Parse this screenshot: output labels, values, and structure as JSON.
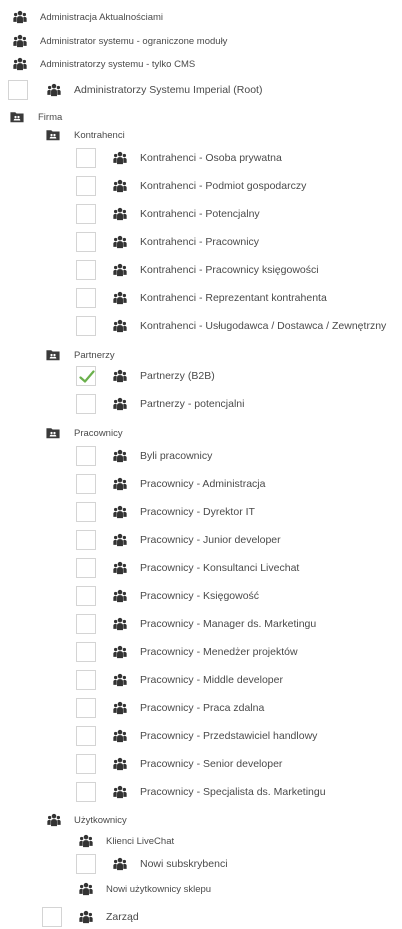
{
  "top_items": [
    {
      "label": "Administracja Aktualnościami"
    },
    {
      "label": "Administrator systemu - ograniczone moduły"
    },
    {
      "label": "Administratorzy systemu - tylko CMS"
    }
  ],
  "root_item": {
    "label": "Administratorzy Systemu Imperial (Root)",
    "checked": false
  },
  "firma": {
    "label": "Firma",
    "kontrahenci": {
      "label": "Kontrahenci",
      "items": [
        {
          "label": "Kontrahenci - Osoba prywatna",
          "checked": false
        },
        {
          "label": "Kontrahenci - Podmiot gospodarczy",
          "checked": false
        },
        {
          "label": "Kontrahenci - Potencjalny",
          "checked": false
        },
        {
          "label": "Kontrahenci - Pracownicy",
          "checked": false
        },
        {
          "label": "Kontrahenci - Pracownicy księgowości",
          "checked": false
        },
        {
          "label": "Kontrahenci - Reprezentant kontrahenta",
          "checked": false
        },
        {
          "label": "Kontrahenci - Usługodawca / Dostawca / Zewnętrzny",
          "checked": false
        }
      ]
    },
    "partnerzy": {
      "label": "Partnerzy",
      "items": [
        {
          "label": "Partnerzy (B2B)",
          "checked": true
        },
        {
          "label": "Partnerzy - potencjalni",
          "checked": false
        }
      ]
    },
    "pracownicy": {
      "label": "Pracownicy",
      "items": [
        {
          "label": "Byli pracownicy",
          "checked": false
        },
        {
          "label": "Pracownicy - Administracja",
          "checked": false
        },
        {
          "label": "Pracownicy - Dyrektor IT",
          "checked": false
        },
        {
          "label": "Pracownicy - Junior developer",
          "checked": false
        },
        {
          "label": "Pracownicy - Konsultanci Livechat",
          "checked": false
        },
        {
          "label": "Pracownicy - Księgowość",
          "checked": false
        },
        {
          "label": "Pracownicy - Manager ds. Marketingu",
          "checked": false
        },
        {
          "label": "Pracownicy - Menedżer projektów",
          "checked": false
        },
        {
          "label": "Pracownicy - Middle developer",
          "checked": false
        },
        {
          "label": "Pracownicy - Praca zdalna",
          "checked": false
        },
        {
          "label": "Pracownicy - Przedstawiciel handlowy",
          "checked": false
        },
        {
          "label": "Pracownicy - Senior developer",
          "checked": false
        },
        {
          "label": "Pracownicy - Specjalista ds. Marketingu",
          "checked": false
        }
      ]
    }
  },
  "uzytkownicy": {
    "label": "Użytkownicy",
    "items": [
      {
        "label": "Klienci LiveChat"
      },
      {
        "label": "Nowi subskrybenci",
        "checked": false
      },
      {
        "label": "Nowi użytkownicy sklepu"
      }
    ]
  },
  "zarzad": {
    "label": "Zarząd",
    "checked": false
  },
  "colors": {
    "check": "#6ab04c",
    "icon": "#333333",
    "checkbox_border": "#d4d4d4"
  }
}
